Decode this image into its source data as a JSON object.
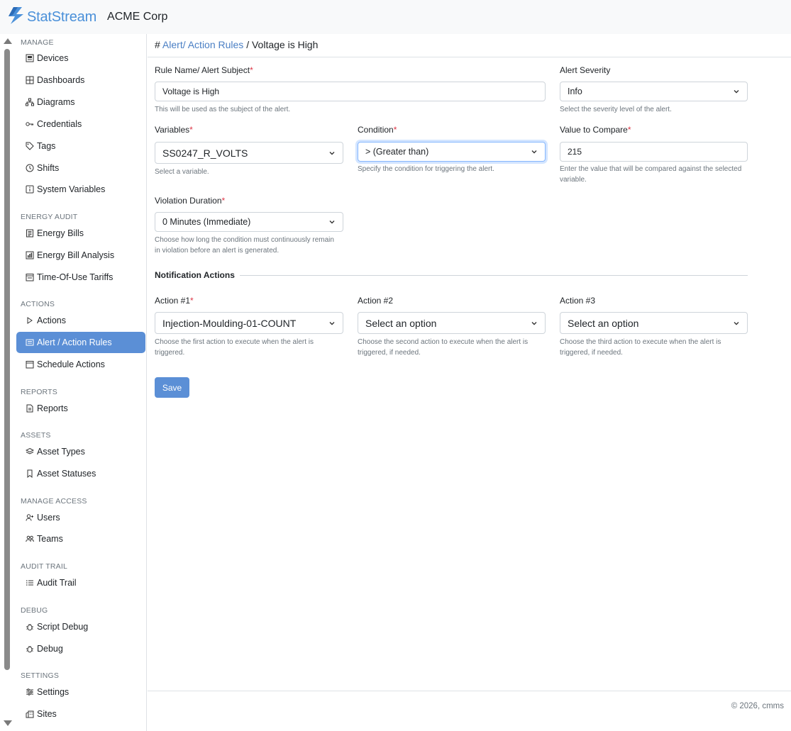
{
  "brand": {
    "name": "StatStream",
    "org": "ACME Corp",
    "accent": "#4a90d9"
  },
  "sidebar": {
    "sections": [
      {
        "title": "MANAGE",
        "items": [
          {
            "label": "Devices",
            "icon": "devices-icon"
          },
          {
            "label": "Dashboards",
            "icon": "dashboard-icon"
          },
          {
            "label": "Diagrams",
            "icon": "diagram-icon"
          },
          {
            "label": "Credentials",
            "icon": "key-icon"
          },
          {
            "label": "Tags",
            "icon": "tag-icon"
          },
          {
            "label": "Shifts",
            "icon": "clock-icon"
          },
          {
            "label": "System Variables",
            "icon": "info-square-icon"
          }
        ]
      },
      {
        "title": "ENERGY AUDIT",
        "items": [
          {
            "label": "Energy Bills",
            "icon": "bill-icon"
          },
          {
            "label": "Energy Bill Analysis",
            "icon": "bar-chart-icon"
          },
          {
            "label": "Time-Of-Use Tariffs",
            "icon": "calendar-range-icon"
          }
        ]
      },
      {
        "title": "ACTIONS",
        "items": [
          {
            "label": "Actions",
            "icon": "play-icon"
          },
          {
            "label": "Alert / Action Rules",
            "icon": "rules-icon",
            "active": true
          },
          {
            "label": "Schedule Actions",
            "icon": "calendar-icon"
          }
        ]
      },
      {
        "title": "REPORTS",
        "items": [
          {
            "label": "Reports",
            "icon": "file-icon"
          }
        ]
      },
      {
        "title": "ASSETS",
        "items": [
          {
            "label": "Asset Types",
            "icon": "layers-icon"
          },
          {
            "label": "Asset Statuses",
            "icon": "bookmark-icon"
          }
        ]
      },
      {
        "title": "MANAGE ACCESS",
        "items": [
          {
            "label": "Users",
            "icon": "user-add-icon"
          },
          {
            "label": "Teams",
            "icon": "team-icon"
          }
        ]
      },
      {
        "title": "AUDIT TRAIL",
        "items": [
          {
            "label": "Audit Trail",
            "icon": "list-icon"
          }
        ]
      },
      {
        "title": "DEBUG",
        "items": [
          {
            "label": "Script Debug",
            "icon": "bug-icon"
          },
          {
            "label": "Debug",
            "icon": "bug-icon"
          }
        ]
      },
      {
        "title": "SETTINGS",
        "items": [
          {
            "label": "Settings",
            "icon": "sliders-icon"
          },
          {
            "label": "Sites",
            "icon": "buildings-icon"
          }
        ]
      }
    ]
  },
  "breadcrumb": {
    "hash": "#",
    "parent": "Alert/ Action Rules",
    "separator": "/",
    "current": "Voltage is High"
  },
  "form": {
    "rule_name": {
      "label": "Rule Name/ Alert Subject",
      "required": "*",
      "value": "Voltage is High",
      "help": "This will be used as the subject of the alert."
    },
    "severity": {
      "label": "Alert Severity",
      "value": "Info",
      "help": "Select the severity level of the alert."
    },
    "variables": {
      "label": "Variables",
      "required": "*",
      "value": "SS0247_R_VOLTS",
      "help": "Select a variable."
    },
    "condition": {
      "label": "Condition",
      "required": "*",
      "value": "> (Greater than)",
      "help": "Specify the condition for triggering the alert."
    },
    "value_to_compare": {
      "label": "Value to Compare",
      "required": "*",
      "value": "215",
      "help": "Enter the value that will be compared against the selected variable."
    },
    "violation_duration": {
      "label": "Violation Duration",
      "required": "*",
      "value": "0 Minutes (Immediate)",
      "help": "Choose how long the condition must continuously remain in violation before an alert is generated."
    },
    "notification_heading": "Notification Actions",
    "action1": {
      "label": "Action #1",
      "required": "*",
      "value": "Injection-Moulding-01-COUNT",
      "help": "Choose the first action to execute when the alert is triggered."
    },
    "action2": {
      "label": "Action #2",
      "value": "Select an option",
      "help": "Choose the second action to execute when the alert is triggered, if needed."
    },
    "action3": {
      "label": "Action #3",
      "value": "Select an option",
      "help": "Choose the third action to execute when the alert is triggered, if needed."
    },
    "save_label": "Save"
  },
  "footer": {
    "text": "© 2026, cmms"
  }
}
